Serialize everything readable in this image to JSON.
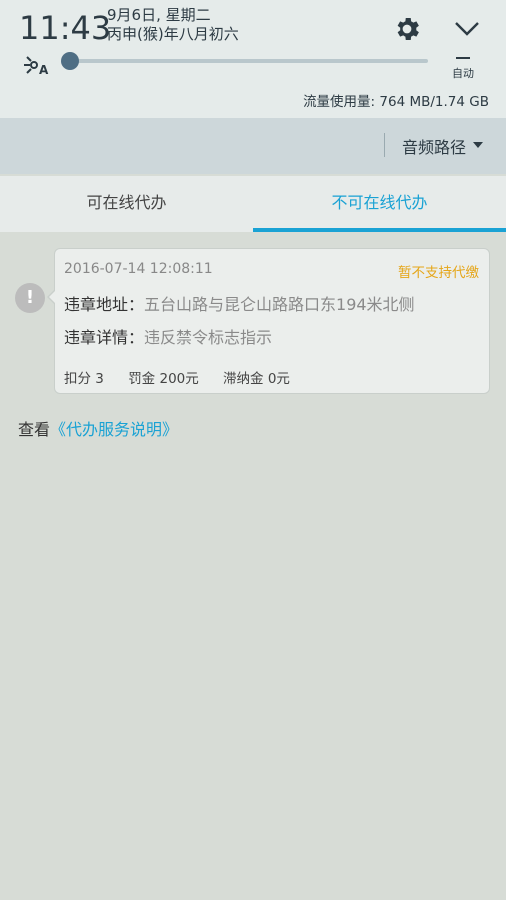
{
  "status": {
    "time": "11:43",
    "date_line1": "9月6日, 星期二",
    "date_line2": "丙申(猴)年八月初六",
    "brightness_level": 0.0,
    "auto_label": "自动",
    "data_usage": "流量使用量: 764 MB/1.74 GB"
  },
  "toolbar": {
    "audio_route_label": "音频路径"
  },
  "tabs": [
    {
      "label": "可在线代办",
      "active": false
    },
    {
      "label": "不可在线代办",
      "active": true
    }
  ],
  "violation": {
    "time": "2016-07-14 12:08:11",
    "status": "暂不支持代缴",
    "address_label": "违章地址：",
    "address_value": "五台山路与昆仑山路路口东194米北侧",
    "detail_label": "违章详情：",
    "detail_value": "违反禁令标志指示",
    "points": "扣分 3",
    "fine": "罚金 200元",
    "late_fee": "滞纳金 0元",
    "warn_glyph": "!"
  },
  "service": {
    "prefix": "查看",
    "link": "《代办服务说明》"
  },
  "colors": {
    "accent": "#1aa2d4",
    "warning": "#e5a619"
  }
}
